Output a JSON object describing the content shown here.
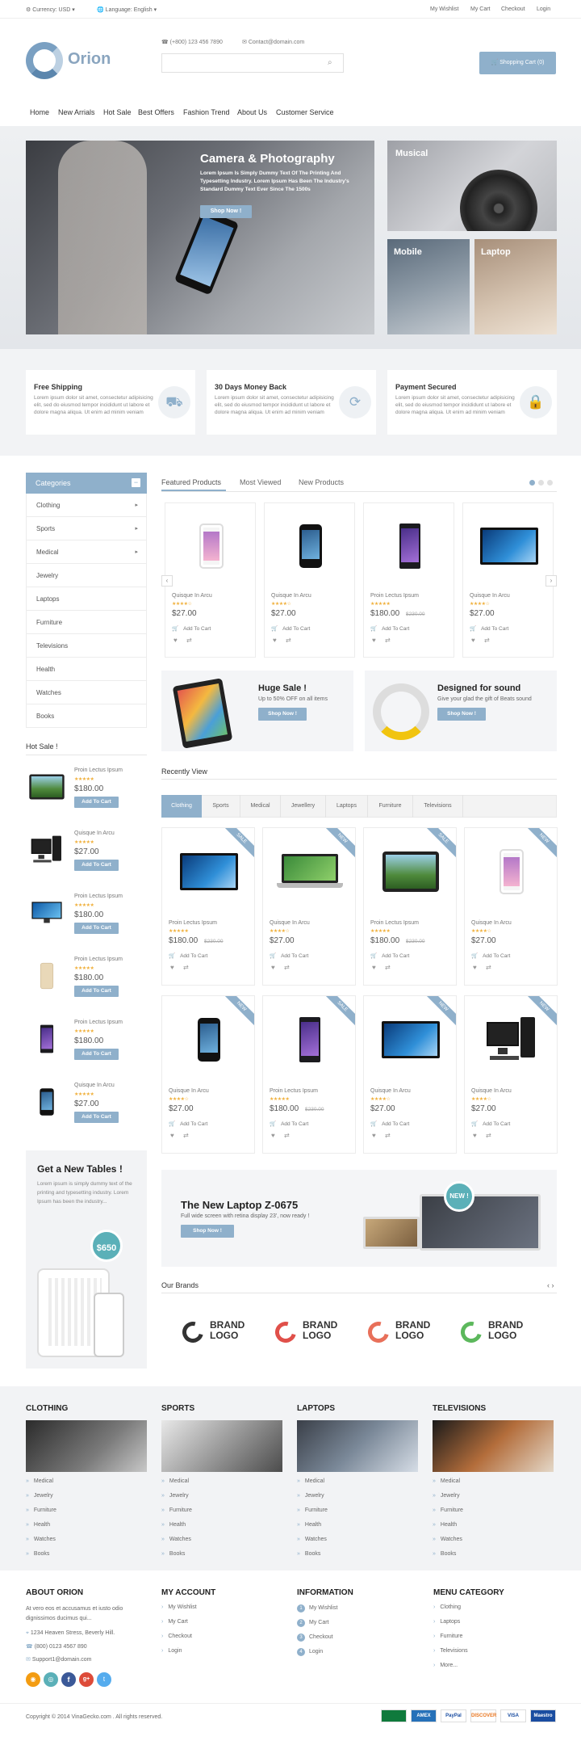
{
  "topbar": {
    "currency": "Currency: USD",
    "language": "Language: English",
    "links": [
      "My Wishlist",
      "My Cart",
      "Checkout",
      "Login"
    ]
  },
  "header": {
    "logo": "Orion",
    "phone": "(+800) 123 456 7890",
    "email": "Contact@domain.com",
    "cart": "Shopping Cart (0)"
  },
  "nav": [
    "Home",
    "New Arrials",
    "Hot Sale",
    "Best Offers",
    "Fashion Trend",
    "About Us",
    "Customer Service"
  ],
  "hero": {
    "title": "Camera & Photography",
    "text": "Lorem Ipsum Is Simply Dummy Text Of The Printing And Typesetting Industry. Lorem Ipsum Has Been The Industry's Standard Dummy Text Ever Since The 1500s",
    "button": "Shop Now !",
    "tiles": [
      "Musical",
      "Mobile",
      "Laptop"
    ]
  },
  "features": [
    {
      "title": "Free Shipping",
      "text": "Lorem ipsum dolor sit amet, consectetur adipisicing elit, sed do eiusmod tempor incididunt ut labore et dolore magna aliqua. Ut enim ad minim veniam",
      "icon": "truck-icon"
    },
    {
      "title": "30 Days Money Back",
      "text": "Lorem ipsum dolor sit amet, consectetur adipisicing elit, sed do eiusmod tempor incididunt ut labore et dolore magna aliqua. Ut enim ad minim veniam",
      "icon": "refresh-icon"
    },
    {
      "title": "Payment Secured",
      "text": "Lorem ipsum dolor sit amet, consectetur adipisicing elit, sed do eiusmod tempor incididunt ut labore et dolore magna aliqua. Ut enim ad minim veniam",
      "icon": "lock-icon"
    }
  ],
  "categories": {
    "title": "Categories",
    "items": [
      "Clothing",
      "Sports",
      "Medical",
      "Jewelry",
      "Laptops",
      "Furniture",
      "Televisions",
      "Health",
      "Watches",
      "Books"
    ]
  },
  "hotsale": {
    "title": "Hot Sale !",
    "button": "Add To Cart",
    "items": [
      {
        "name": "Proin Lectus Ipsum",
        "price": "$180.00"
      },
      {
        "name": "Quisque In Arcu",
        "price": "$27.00"
      },
      {
        "name": "Proin Lectus Ipsum",
        "price": "$180.00"
      },
      {
        "name": "Proin Lectus Ipsum",
        "price": "$180.00"
      },
      {
        "name": "Proin Lectus Ipsum",
        "price": "$180.00"
      },
      {
        "name": "Quisque In Arcu",
        "price": "$27.00"
      }
    ]
  },
  "promo_side": {
    "title": "Get a New Tables !",
    "text": "Lorem ipsum is simply dummy text of the printing and typesetting industry. Lorem Ipsum has been the industry...",
    "price": "$650"
  },
  "featured": {
    "tabs": [
      "Featured Products",
      "Most Viewed",
      "New Products"
    ],
    "add": "Add To Cart",
    "items": [
      {
        "name": "Quisque In Arcu",
        "price": "$27.00",
        "old": ""
      },
      {
        "name": "Quisque In Arcu",
        "price": "$27.00",
        "old": ""
      },
      {
        "name": "Proin Lectus Ipsum",
        "price": "$180.00",
        "old": "$230.00"
      },
      {
        "name": "Quisque In Arcu",
        "price": "$27.00",
        "old": ""
      }
    ]
  },
  "banners": [
    {
      "title": "Huge Sale !",
      "text": "Up to 50% OFF on all items",
      "button": "Shop Now !"
    },
    {
      "title": "Designed for sound",
      "text": "Give your glad the gift of Beats sound",
      "button": "Shop Now !"
    }
  ],
  "recent": {
    "title": "Recently View",
    "tabs": [
      "Clothing",
      "Sports",
      "Medical",
      "Jewellery",
      "Laptops",
      "Furniture",
      "Televisions"
    ],
    "add": "Add To Cart",
    "items": [
      {
        "name": "Proin Lectus Ipsum",
        "price": "$180.00",
        "old": "$230.00",
        "badge": "SALE"
      },
      {
        "name": "Quisque In Arcu",
        "price": "$27.00",
        "old": "",
        "badge": "NEW"
      },
      {
        "name": "Proin Lectus Ipsum",
        "price": "$180.00",
        "old": "$230.00",
        "badge": "SALE"
      },
      {
        "name": "Quisque In Arcu",
        "price": "$27.00",
        "old": "",
        "badge": "NEW"
      },
      {
        "name": "Quisque In Arcu",
        "price": "$27.00",
        "old": "",
        "badge": "NEW"
      },
      {
        "name": "Proin Lectus Ipsum",
        "price": "$180.00",
        "old": "$230.00",
        "badge": "SALE"
      },
      {
        "name": "Quisque In Arcu",
        "price": "$27.00",
        "old": "",
        "badge": "NEW"
      },
      {
        "name": "Quisque In Arcu",
        "price": "$27.00",
        "old": "",
        "badge": "NEW"
      }
    ]
  },
  "laptop_banner": {
    "title": "The New Laptop Z-0675",
    "text": "Full wide screen with retina display 23', now ready !",
    "button": "Shop Now !",
    "badge": "NEW !"
  },
  "brands": {
    "title": "Our Brands",
    "items": [
      "BRAND LOGO",
      "BRAND LOGO",
      "BRAND LOGO",
      "BRAND LOGO"
    ],
    "colors": [
      "#333333",
      "#e0504a",
      "#e8705a",
      "#5cb85c"
    ]
  },
  "footer_cats": [
    {
      "title": "CLOTHING",
      "items": [
        "Medical",
        "Jewelry",
        "Furniture",
        "Health",
        "Watches",
        "Books"
      ]
    },
    {
      "title": "SPORTS",
      "items": [
        "Medical",
        "Jewelry",
        "Furniture",
        "Health",
        "Watches",
        "Books"
      ]
    },
    {
      "title": "LAPTOPS",
      "items": [
        "Medical",
        "Jewelry",
        "Furniture",
        "Health",
        "Watches",
        "Books"
      ]
    },
    {
      "title": "TELEVISIONS",
      "items": [
        "Medical",
        "Jewelry",
        "Furniture",
        "Health",
        "Watches",
        "Books"
      ]
    }
  ],
  "footer": {
    "about": {
      "title": "ABOUT ORION",
      "text": "At vero eos et accusamus et iusto odio dignissimos ducimus qui...",
      "address": "1234 Heaven Stress, Beverly Hill.",
      "phone": "(800) 0123 4567 890",
      "email": "Support1@domain.com"
    },
    "account": {
      "title": "MY ACCOUNT",
      "items": [
        "My Wishlist",
        "My Cart",
        "Checkout",
        "Login"
      ]
    },
    "info": {
      "title": "INFORMATION",
      "items": [
        "My Wishlist",
        "My Cart",
        "Checkout",
        "Login"
      ]
    },
    "menu": {
      "title": "MENU CATEGORY",
      "items": [
        "Clothing",
        "Laptops",
        "Furniture",
        "Televisions",
        "More..."
      ]
    },
    "copyright": "Copyright © 2014 VinaGecko.com . All rights reserved.",
    "payments": [
      "",
      "AMEX",
      "PayPal",
      "DISCOVER",
      "VISA",
      "Maestro"
    ]
  },
  "colors": {
    "accent": "#8fb0cb"
  }
}
